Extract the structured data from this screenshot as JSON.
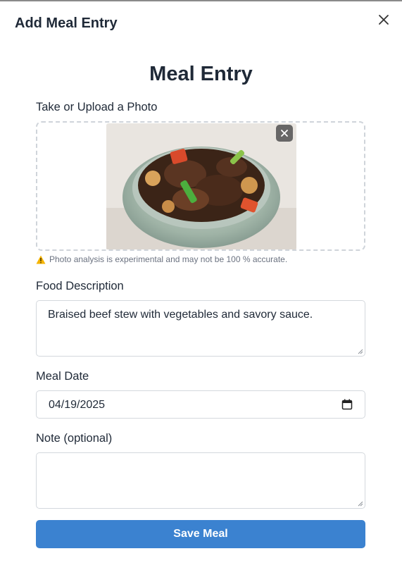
{
  "modal": {
    "title": "Add Meal Entry",
    "close_icon": "close-icon"
  },
  "form": {
    "heading": "Meal Entry",
    "photo": {
      "label": "Take or Upload a Photo",
      "remove_icon": "close-icon",
      "warning": "Photo analysis is experimental and may not be 100 % accurate.",
      "warning_icon": "warning-icon"
    },
    "description": {
      "label": "Food Description",
      "value": "Braised beef stew with vegetables and savory sauce."
    },
    "date": {
      "label": "Meal Date",
      "value": "04/19/2025",
      "icon": "calendar-icon"
    },
    "note": {
      "label": "Note (optional)",
      "value": ""
    },
    "submit_label": "Save Meal"
  },
  "colors": {
    "accent": "#3b82d0",
    "text": "#1f2937",
    "muted": "#6b7280",
    "border": "#d4d8dd"
  }
}
